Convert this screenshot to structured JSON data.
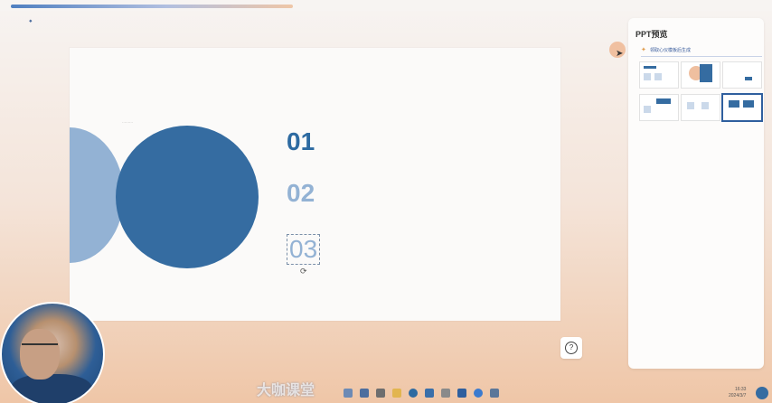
{
  "slide": {
    "numbers": [
      "01",
      "02",
      "03"
    ]
  },
  "panel": {
    "title": "PPT预览",
    "tip": "领取心仪模板后生成"
  },
  "help": {
    "label": "?"
  },
  "watermark": "大咖课堂",
  "clock": {
    "time": "16:33",
    "date": "2024/3/7"
  },
  "icons": {
    "cursor": "arrow-cursor-icon",
    "rotate": "rotate-icon",
    "help": "question-circle-icon",
    "tip": "lightbulb-icon"
  },
  "colors": {
    "primary_blue": "#356ca1",
    "light_blue": "#93b2d4",
    "accent_orange": "#efc6a7"
  }
}
